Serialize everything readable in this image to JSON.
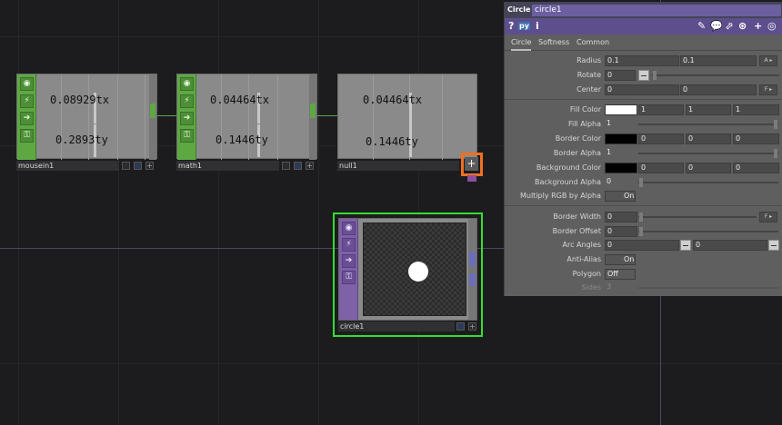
{
  "network": {
    "nodes": [
      {
        "id": "mousein1",
        "label": "mousein1",
        "values": [
          "0.08929tx",
          "0.2893ty"
        ]
      },
      {
        "id": "math1",
        "label": "math1",
        "values": [
          "0.04464tx",
          "0.1446ty"
        ]
      },
      {
        "id": "null1",
        "label": "null1",
        "values": [
          "0.04464tx",
          "0.1446ty"
        ]
      }
    ],
    "top_node": {
      "label": "circle1"
    },
    "colors": {
      "chop": "#5ea844",
      "top": "#7f61a8",
      "selected": "#33dd33",
      "highlight": "#f07020"
    }
  },
  "panel": {
    "type": "Circle",
    "name": "circle1",
    "tools": {
      "help": "?",
      "python": "py",
      "info": "i"
    },
    "tabs": [
      "Circle",
      "Softness",
      "Common"
    ],
    "active_tab": "Circle",
    "params": {
      "radius": {
        "label": "Radius",
        "v1": "0.1",
        "v2": "0.1",
        "btn": "A ▸"
      },
      "rotate": {
        "label": "Rotate",
        "v1": "0"
      },
      "center": {
        "label": "Center",
        "v1": "0",
        "v2": "0",
        "btn": "F ▸"
      },
      "fill_color": {
        "label": "Fill Color",
        "v1": "1",
        "v2": "1",
        "v3": "1",
        "swatch": "#ffffff"
      },
      "fill_alpha": {
        "label": "Fill Alpha",
        "v1": "1"
      },
      "border_color": {
        "label": "Border Color",
        "v1": "0",
        "v2": "0",
        "v3": "0",
        "swatch": "#000000"
      },
      "border_alpha": {
        "label": "Border Alpha",
        "v1": "1"
      },
      "background_color": {
        "label": "Background Color",
        "v1": "0",
        "v2": "0",
        "v3": "0",
        "swatch": "#000000"
      },
      "background_alpha": {
        "label": "Background Alpha",
        "v1": "0"
      },
      "multiply_rgb": {
        "label": "Multiply RGB by Alpha",
        "value": "On"
      },
      "border_width": {
        "label": "Border Width",
        "v1": "0",
        "btn": "F ▸"
      },
      "border_offset": {
        "label": "Border Offset",
        "v1": "0"
      },
      "arc_angles": {
        "label": "Arc Angles",
        "v1": "0",
        "v2": "0"
      },
      "anti_alias": {
        "label": "Anti-Alias",
        "value": "On"
      },
      "polygon": {
        "label": "Polygon",
        "value": "Off"
      },
      "sides": {
        "label": "Sides",
        "v1": "3"
      }
    }
  }
}
